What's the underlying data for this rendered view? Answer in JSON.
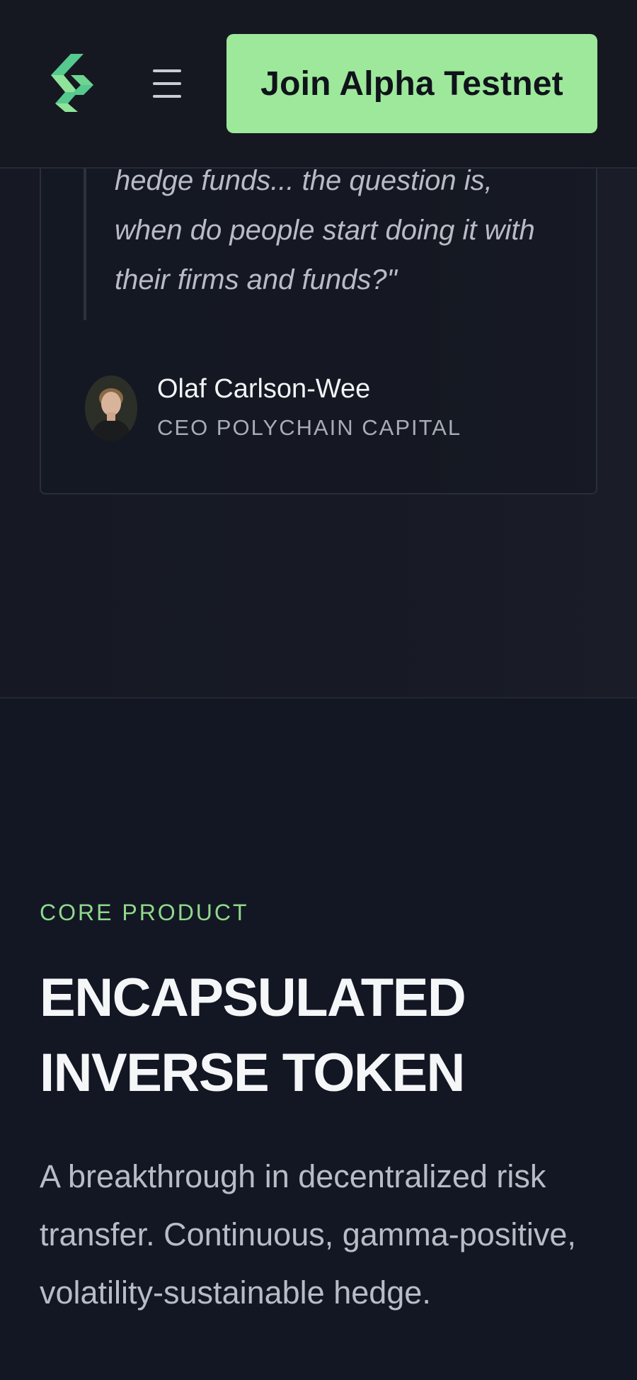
{
  "header": {
    "logo_icon": "chevron-stack-logo-icon",
    "menu_icon": "hamburger-menu-icon",
    "cta_label": "Join Alpha Testnet",
    "accent_color": "#9de89a"
  },
  "testimonial": {
    "quote": "hedge funds... the question is, when do people start doing it with their firms and funds?\"",
    "author_name": "Olaf Carlson-Wee",
    "author_role": "CEO POLYCHAIN CAPITAL"
  },
  "core_product": {
    "eyebrow": "CORE PRODUCT",
    "title_line_1": "ENCAPSULATED",
    "title_line_2": "INVERSE TOKEN",
    "description": "A breakthrough in decentralized risk transfer. Continuous, gamma-positive, volatility-sustainable hedge.",
    "eyebrow_color": "#8fd98c"
  }
}
